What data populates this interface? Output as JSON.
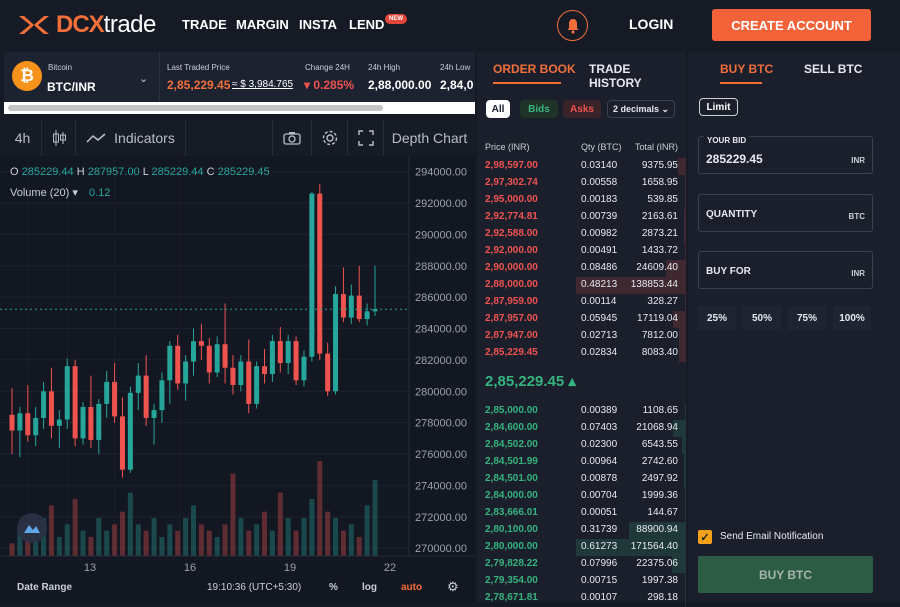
{
  "nav": {
    "brand_dcx": "DCX",
    "brand_trade": "trade",
    "links": [
      "TRADE",
      "MARGIN",
      "INSTA",
      "LEND"
    ],
    "new_badge": "NEW",
    "login": "LOGIN",
    "create_account": "CREATE ACCOUNT",
    "accent": "#f4623a"
  },
  "ticker": {
    "coin_name": "Bitcoin",
    "pair": "BTC/INR",
    "ltp_label": "Last Traded Price",
    "ltp": "2,85,229.45",
    "ltp_usd": "≈ $ 3,984.765",
    "change_label": "Change 24H",
    "change": "▾ 0.285%",
    "high_label": "24h High",
    "high": "2,88,000.00",
    "low_label": "24h Low",
    "low": "2,84,0"
  },
  "chart_tools": {
    "interval": "4h",
    "indicators": "Indicators",
    "depth_chart": "Depth Chart"
  },
  "chart_data": {
    "type": "candlestick",
    "ohlc_label": {
      "o": "O",
      "ov": "285229.44",
      "h": "H",
      "hv": "287957.00",
      "l": "L",
      "lv": "285229.44",
      "c": "C",
      "cv": "285229.45"
    },
    "volume_label": "Volume (20) ▾",
    "volume_value": "0.12",
    "y_ticks": [
      "294000.00",
      "292000.00",
      "290000.00",
      "288000.00",
      "286000.00",
      "284000.00",
      "282000.00",
      "280000.00",
      "278000.00",
      "276000.00",
      "274000.00",
      "272000.00",
      "270000.00"
    ],
    "ylim": [
      269500,
      295000
    ],
    "current_price": "285229.45",
    "x_ticks": [
      "13",
      "16",
      "19",
      "22"
    ],
    "date_range": "Date Range",
    "time": "19:10:36 (UTC+5:30)",
    "pct_toggle": "%",
    "log_toggle": "log",
    "auto_toggle": "auto",
    "up_color": "#26a69a",
    "down_color": "#ef5350",
    "candles": [
      [
        278500,
        280200,
        276000,
        277500
      ],
      [
        277500,
        279000,
        275800,
        278600
      ],
      [
        278600,
        280400,
        276800,
        277200
      ],
      [
        277200,
        279000,
        276500,
        278300
      ],
      [
        278300,
        280600,
        277600,
        280000
      ],
      [
        280000,
        281500,
        277000,
        277800
      ],
      [
        277800,
        278800,
        276400,
        278200
      ],
      [
        278200,
        282100,
        277600,
        281600
      ],
      [
        281600,
        282000,
        276500,
        277000
      ],
      [
        277000,
        279300,
        276600,
        279000
      ],
      [
        279000,
        281000,
        276400,
        276900
      ],
      [
        276900,
        279500,
        276000,
        279200
      ],
      [
        279200,
        281300,
        278300,
        280600
      ],
      [
        280600,
        281800,
        278000,
        278400
      ],
      [
        278400,
        279600,
        274500,
        275000
      ],
      [
        275000,
        280300,
        274800,
        279900
      ],
      [
        279900,
        281800,
        278800,
        281000
      ],
      [
        281000,
        282300,
        277800,
        278300
      ],
      [
        278300,
        279200,
        276600,
        278800
      ],
      [
        278800,
        281200,
        278000,
        280700
      ],
      [
        280700,
        283200,
        279200,
        282900
      ],
      [
        282900,
        283600,
        280100,
        280500
      ],
      [
        280500,
        282300,
        279400,
        281900
      ],
      [
        281900,
        284000,
        281000,
        283200
      ],
      [
        283200,
        284300,
        282000,
        282900
      ],
      [
        282900,
        283400,
        280500,
        281200
      ],
      [
        281200,
        283500,
        280900,
        283000
      ],
      [
        283000,
        285600,
        280500,
        281500
      ],
      [
        281500,
        282300,
        279800,
        280400
      ],
      [
        280400,
        282300,
        280000,
        281900
      ],
      [
        281900,
        283300,
        278600,
        279200
      ],
      [
        279200,
        281900,
        278900,
        281600
      ],
      [
        281600,
        282700,
        280500,
        281100
      ],
      [
        281100,
        283600,
        280600,
        283200
      ],
      [
        283200,
        284100,
        281200,
        281800
      ],
      [
        281800,
        283600,
        281100,
        283200
      ],
      [
        283200,
        283500,
        280400,
        280700
      ],
      [
        280700,
        282600,
        280300,
        282200
      ],
      [
        282200,
        292700,
        281900,
        292600
      ],
      [
        292600,
        293200,
        282000,
        282400
      ],
      [
        282400,
        283100,
        279700,
        280000
      ],
      [
        280000,
        286700,
        279800,
        286200
      ],
      [
        286200,
        287900,
        284400,
        284700
      ],
      [
        284700,
        286800,
        284300,
        286100
      ],
      [
        286100,
        288000,
        284400,
        284600
      ],
      [
        284600,
        285600,
        284200,
        285100
      ],
      [
        285100,
        288000,
        284800,
        285229
      ]
    ],
    "volumes": [
      0.02,
      0.05,
      0.03,
      0.04,
      0.06,
      0.08,
      0.03,
      0.05,
      0.09,
      0.04,
      0.03,
      0.06,
      0.04,
      0.05,
      0.07,
      0.1,
      0.05,
      0.04,
      0.06,
      0.03,
      0.05,
      0.04,
      0.06,
      0.08,
      0.05,
      0.04,
      0.03,
      0.05,
      0.13,
      0.06,
      0.04,
      0.05,
      0.07,
      0.04,
      0.1,
      0.06,
      0.04,
      0.06,
      0.09,
      0.15,
      0.07,
      0.06,
      0.04,
      0.05,
      0.03,
      0.08,
      0.12
    ]
  },
  "order_book": {
    "tabs": [
      "ORDER BOOK",
      "TRADE HISTORY"
    ],
    "filters": [
      "All",
      "Bids",
      "Asks"
    ],
    "decimals": "2 decimals ⌄",
    "headers": [
      "Price (INR)",
      "Qty (BTC)",
      "Total (INR)"
    ],
    "asks": [
      {
        "p": "2,98,597.00",
        "q": "0.03140",
        "t": "9375.95",
        "d": 0.07
      },
      {
        "p": "2,97,302.74",
        "q": "0.00558",
        "t": "1658.95",
        "d": 0.01
      },
      {
        "p": "2,95,000.00",
        "q": "0.00183",
        "t": "539.85",
        "d": 0.01
      },
      {
        "p": "2,92,774.81",
        "q": "0.00739",
        "t": "2163.61",
        "d": 0.02
      },
      {
        "p": "2,92,588.00",
        "q": "0.00982",
        "t": "2873.21",
        "d": 0.02
      },
      {
        "p": "2,92,000.00",
        "q": "0.00491",
        "t": "1433.72",
        "d": 0.01
      },
      {
        "p": "2,90,000.00",
        "q": "0.08486",
        "t": "24609.40",
        "d": 0.18
      },
      {
        "p": "2,88,000.00",
        "q": "0.48213",
        "t": "138853.44",
        "d": 1.0
      },
      {
        "p": "2,87,959.00",
        "q": "0.00114",
        "t": "328.27",
        "d": 0.01
      },
      {
        "p": "2,87,957.00",
        "q": "0.05945",
        "t": "17119.04",
        "d": 0.12
      },
      {
        "p": "2,87,947.00",
        "q": "0.02713",
        "t": "7812.00",
        "d": 0.06
      },
      {
        "p": "2,85,229.45",
        "q": "0.02834",
        "t": "8083.40",
        "d": 0.06
      }
    ],
    "ltp": "2,85,229.45 ▴",
    "bids": [
      {
        "p": "2,85,000.00",
        "q": "0.00389",
        "t": "1108.65",
        "d": 0.01
      },
      {
        "p": "2,84,600.00",
        "q": "0.07403",
        "t": "21068.94",
        "d": 0.12
      },
      {
        "p": "2,84,502.00",
        "q": "0.02300",
        "t": "6543.55",
        "d": 0.04
      },
      {
        "p": "2,84,501.99",
        "q": "0.00964",
        "t": "2742.60",
        "d": 0.02
      },
      {
        "p": "2,84,501.00",
        "q": "0.00878",
        "t": "2497.92",
        "d": 0.02
      },
      {
        "p": "2,84,000.00",
        "q": "0.00704",
        "t": "1999.36",
        "d": 0.01
      },
      {
        "p": "2,83,666.01",
        "q": "0.00051",
        "t": "144.67",
        "d": 0.0
      },
      {
        "p": "2,80,100.00",
        "q": "0.31739",
        "t": "88900.94",
        "d": 0.52
      },
      {
        "p": "2,80,000.00",
        "q": "0.61273",
        "t": "171564.40",
        "d": 1.0
      },
      {
        "p": "2,79,828.22",
        "q": "0.07996",
        "t": "22375.06",
        "d": 0.13
      },
      {
        "p": "2,79,354.00",
        "q": "0.00715",
        "t": "1997.38",
        "d": 0.01
      },
      {
        "p": "2,78,671.81",
        "q": "0.00107",
        "t": "298.18",
        "d": 0.0
      }
    ]
  },
  "trade_panel": {
    "tabs": [
      "BUY BTC",
      "SELL BTC"
    ],
    "limit": "Limit",
    "bid_label": "YOUR BID",
    "bid_value": "285229.45",
    "bid_unit": "INR",
    "qty_label": "QUANTITY",
    "qty_unit": "BTC",
    "buyfor_label": "BUY FOR",
    "buyfor_unit": "INR",
    "percents": [
      "25%",
      "50%",
      "75%",
      "100%"
    ],
    "email": "Send Email Notification",
    "buy_button": "BUY BTC"
  }
}
